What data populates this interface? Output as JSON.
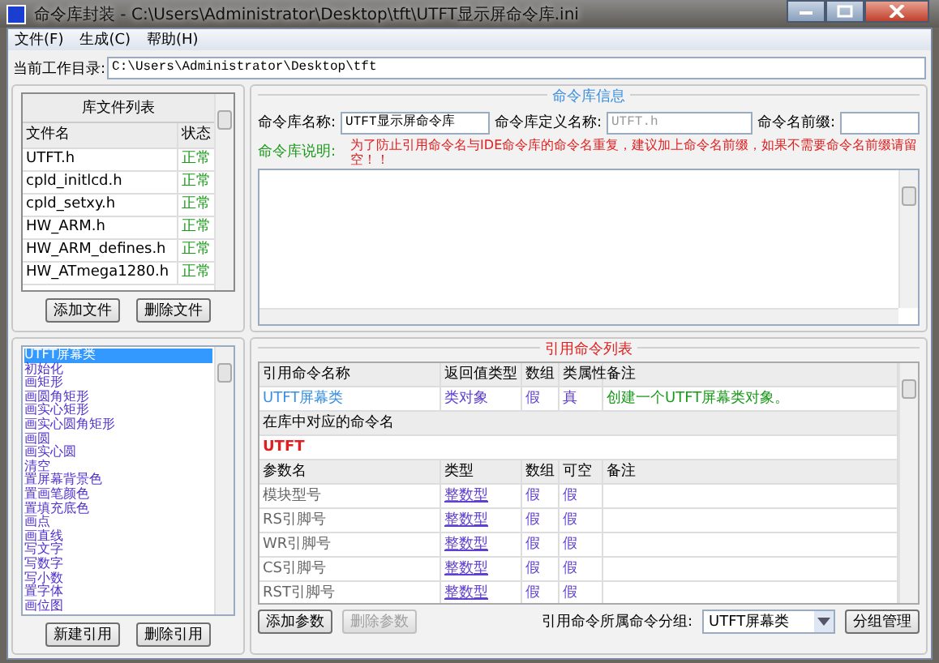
{
  "window": {
    "title": "命令库封装 - C:\\Users\\Administrator\\Desktop\\tft\\UTFT显示屏命令库.ini"
  },
  "menu": [
    "文件(F)",
    "生成(C)",
    "帮助(H)"
  ],
  "workdir": {
    "label": "当前工作目录:",
    "value": "C:\\Users\\Administrator\\Desktop\\tft"
  },
  "files": {
    "title": "库文件列表",
    "columns": [
      "文件名",
      "状态"
    ],
    "rows": [
      {
        "name": "UTFT.h",
        "status": "正常"
      },
      {
        "name": "cpld_initlcd.h",
        "status": "正常"
      },
      {
        "name": "cpld_setxy.h",
        "status": "正常"
      },
      {
        "name": "HW_ARM.h",
        "status": "正常"
      },
      {
        "name": "HW_ARM_defines.h",
        "status": "正常"
      },
      {
        "name": "HW_ATmega1280.h",
        "status": "正常"
      }
    ],
    "buttons": [
      "添加文件",
      "删除文件"
    ]
  },
  "lib_info": {
    "title": "命令库信息",
    "name_label": "命令库名称:",
    "name_value": "UTFT显示屏命令库",
    "def_label": "命令库定义名称:",
    "def_placeholder": "UTFT.h",
    "prefix_label": "命令名前缀:",
    "desc_label": "命令库说明:",
    "desc_note": "为了防止引用命令名与IDE命令库的命令名重复，建议加上命令名前缀，如果不需要命令名前缀请留空！！"
  },
  "commands": [
    {
      "label": "UTFT屏幕类",
      "selected": true
    },
    {
      "label": "初始化",
      "selected": false
    },
    {
      "label": "画矩形",
      "selected": false
    },
    {
      "label": "画圆角矩形",
      "selected": false
    },
    {
      "label": "画实心矩形",
      "selected": false
    },
    {
      "label": "画实心圆角矩形",
      "selected": false
    },
    {
      "label": "画圆",
      "selected": false
    },
    {
      "label": "画实心圆",
      "selected": false
    },
    {
      "label": "清空",
      "selected": false
    },
    {
      "label": "置屏幕背景色",
      "selected": false
    },
    {
      "label": "置画笔颜色",
      "selected": false
    },
    {
      "label": "置填充底色",
      "selected": false
    },
    {
      "label": "画点",
      "selected": false
    },
    {
      "label": "画直线",
      "selected": false
    },
    {
      "label": "写文字",
      "selected": false
    },
    {
      "label": "写数字",
      "selected": false
    },
    {
      "label": "写小数",
      "selected": false
    },
    {
      "label": "置字体",
      "selected": false
    },
    {
      "label": "画位图",
      "selected": false
    }
  ],
  "command_buttons": [
    "新建引用",
    "删除引用"
  ],
  "ref": {
    "title": "引用命令列表",
    "columns": [
      "引用命令名称",
      "返回值类型",
      "数组",
      "类属性",
      "备注"
    ],
    "command": {
      "name": "UTFT屏幕类",
      "type": "类对象",
      "array": "假",
      "class_attr": "真",
      "note": "创建一个UTFT屏幕类对象。"
    },
    "lib_name_label": "在库中对应的命令名",
    "lib_name": "UTFT",
    "param_columns": [
      "参数名",
      "类型",
      "数组",
      "可空",
      "备注"
    ],
    "params": [
      {
        "name": "模块型号",
        "type": "整数型",
        "array": "假",
        "nullable": "假"
      },
      {
        "name": "RS引脚号",
        "type": "整数型",
        "array": "假",
        "nullable": "假"
      },
      {
        "name": "WR引脚号",
        "type": "整数型",
        "array": "假",
        "nullable": "假"
      },
      {
        "name": "CS引脚号",
        "type": "整数型",
        "array": "假",
        "nullable": "假"
      },
      {
        "name": "RST引脚号",
        "type": "整数型",
        "array": "假",
        "nullable": "假"
      }
    ],
    "buttons": [
      {
        "label": "添加参数",
        "disabled": false
      },
      {
        "label": "删除参数",
        "disabled": true
      }
    ],
    "group_label": "引用命令所属命令分组:",
    "group_value": "UTFT屏幕类",
    "group_button": "分组管理"
  }
}
